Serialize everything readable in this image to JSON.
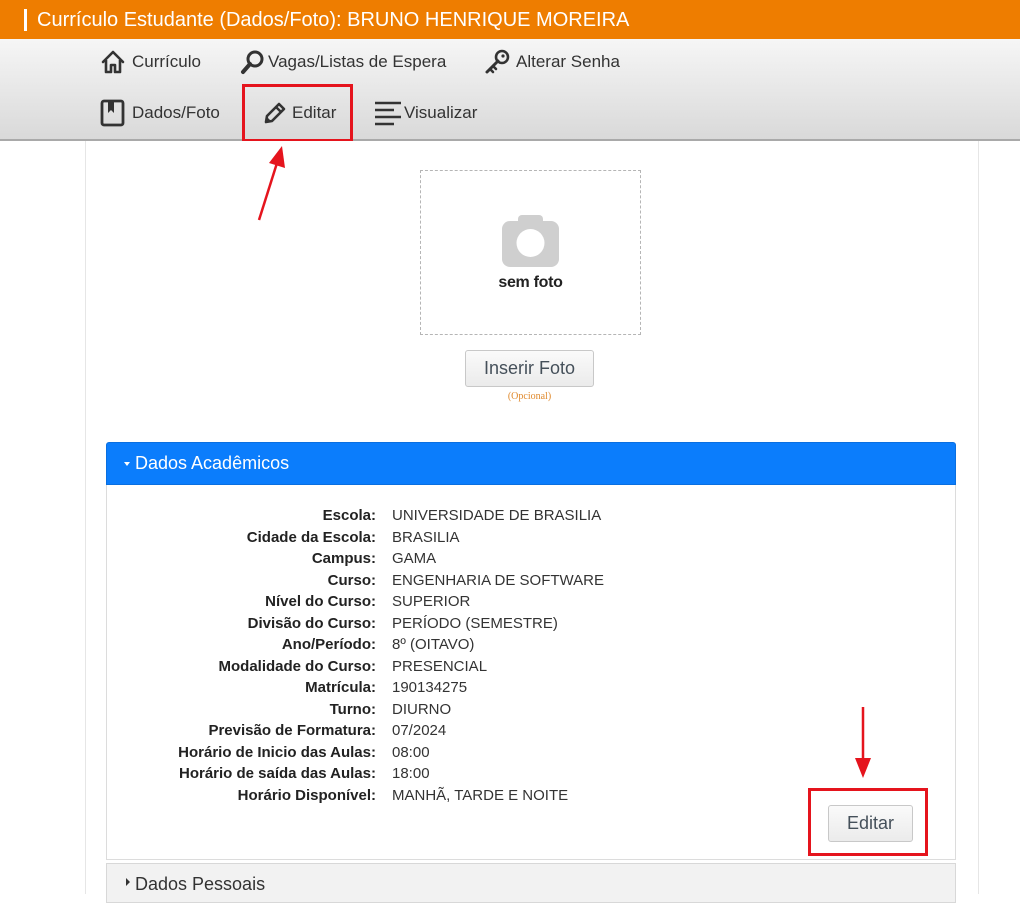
{
  "header": {
    "title": "Currículo Estudante (Dados/Foto): BRUNO HENRIQUE MOREIRA"
  },
  "nav": {
    "curriculo": {
      "label": "Currículo",
      "icon": "home-icon"
    },
    "vagas": {
      "label": "Vagas/Listas de Espera",
      "icon": "search-icon"
    },
    "senha": {
      "label": "Alterar Senha",
      "icon": "key-icon"
    },
    "dados_foto": {
      "label": "Dados/Foto",
      "icon": "book-icon"
    },
    "editar": {
      "label": "Editar",
      "icon": "pencil-icon"
    },
    "visualizar": {
      "label": "Visualizar",
      "icon": "lines-icon"
    }
  },
  "photo": {
    "placeholder": "sem foto",
    "insert_button": "Inserir Foto",
    "optional_note": "(Opcional)"
  },
  "academic": {
    "heading": "Dados Acadêmicos",
    "rows": [
      {
        "key": "Escola:",
        "value": "UNIVERSIDADE DE BRASILIA"
      },
      {
        "key": "Cidade da Escola:",
        "value": "BRASILIA"
      },
      {
        "key": "Campus:",
        "value": "GAMA"
      },
      {
        "key": "Curso:",
        "value": "ENGENHARIA DE SOFTWARE"
      },
      {
        "key": "Nível do Curso:",
        "value": "SUPERIOR"
      },
      {
        "key": "Divisão do Curso:",
        "value": "PERÍODO (SEMESTRE)"
      },
      {
        "key": "Ano/Período:",
        "value": "8º (OITAVO)"
      },
      {
        "key": "Modalidade do Curso:",
        "value": "PRESENCIAL"
      },
      {
        "key": "Matrícula:",
        "value": "190134275"
      },
      {
        "key": "Turno:",
        "value": "DIURNO"
      },
      {
        "key": "Previsão de Formatura:",
        "value": "07/2024"
      },
      {
        "key": "Horário de Inicio das Aulas:",
        "value": "08:00"
      },
      {
        "key": "Horário de saída das Aulas:",
        "value": "18:00"
      },
      {
        "key": "Horário Disponível:",
        "value": "MANHÃ, TARDE E NOITE"
      }
    ],
    "edit_button": "Editar"
  },
  "personal": {
    "heading": "Dados Pessoais"
  },
  "colors": {
    "header_orange": "#ee7d00",
    "panel_blue": "#0b7dfc",
    "annotation_red": "#e5141d"
  }
}
